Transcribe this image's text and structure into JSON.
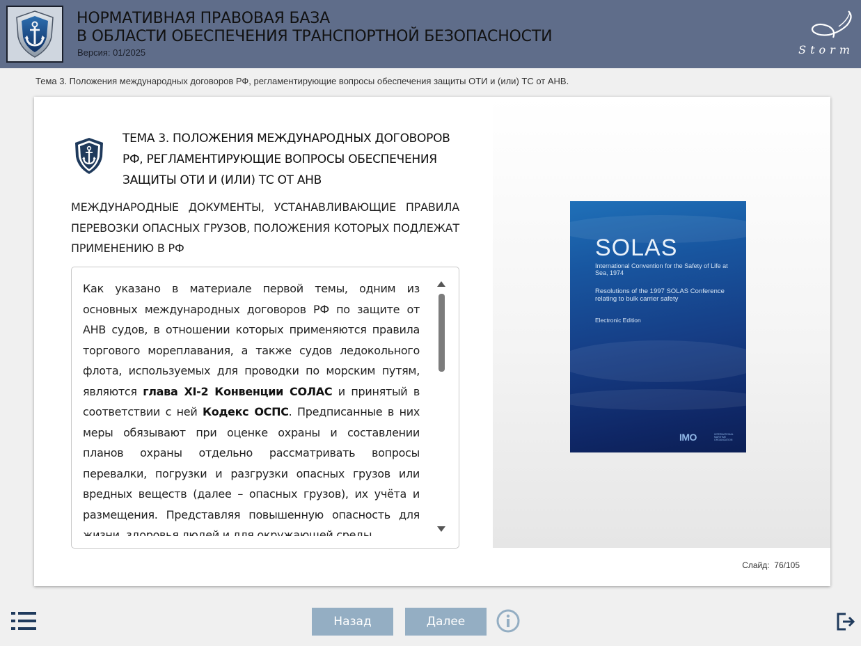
{
  "header": {
    "title_line1": "НОРМАТИВНАЯ ПРАВОВАЯ БАЗА",
    "title_line2": "В ОБЛАСТИ ОБЕСПЕЧЕНИЯ ТРАНСПОРТНОЙ БЕЗОПАСНОСТИ",
    "version": "Версия: 01/2025",
    "brand": "Storm",
    "logo_icon": "anchor-shield-icon"
  },
  "topic_line": "Тема 3. Положения международных договоров РФ, регламентирующие вопросы обеспечения защиты ОТИ и (или) ТС от АНВ.",
  "slide": {
    "heading": "ТЕМА 3. ПОЛОЖЕНИЯ МЕЖДУНАРОДНЫХ ДОГОВОРОВ РФ, РЕГЛАМЕНТИРУЮЩИЕ ВОПРОСЫ ОБЕСПЕЧЕНИЯ ЗАЩИТЫ ОТИ И (ИЛИ) ТС ОТ АНВ",
    "subheading": "МЕЖДУНАРОДНЫЕ ДОКУМЕНТЫ, УСТАНАВЛИВАЮЩИЕ ПРАВИЛА ПЕРЕВОЗКИ ОПАСНЫХ ГРУЗОВ, ПОЛОЖЕНИЯ КОТОРЫХ ПОДЛЕЖАТ ПРИМЕНЕНИЮ В РФ",
    "body_part1": "Как указано в материале первой темы, одним из основных международных договоров РФ по защите от АНВ судов, в отношении которых применяются правила торгового мореплавания, а также судов ледокольного флота, используемых для проводки по морским путям, являются ",
    "body_bold1": "глава XI-2 Конвенции СОЛАС",
    "body_part2": " и принятый в соответствии с ней ",
    "body_bold2": "Кодекс ОСПС",
    "body_part3": ". Предписанные в них меры обязывают при оценке охраны и составлении планов охраны отдельно рассматривать вопросы перевалки, погрузки и разгрузки опасных грузов или вредных веществ (далее – опасных грузов), их учёта и размещения. Представляя повышенную опасность для жизни, здоровья людей и для окружающей среды,",
    "book": {
      "title": "SOLAS",
      "subtitle": "International Convention for the Safety of Life at Sea, 1974",
      "resolutions": "Resolutions of the 1997 SOLAS Conference relating to bulk carrier safety",
      "edition": "Electronic Edition",
      "publisher": "IMO",
      "publisher_sub": "INTERNATIONAL MARITIME ORGANIZATION"
    },
    "counter_label": "Слайд:",
    "counter_current": "76",
    "counter_sep": "/",
    "counter_total": "105"
  },
  "footer": {
    "back_label": "Назад",
    "next_label": "Далее",
    "menu_icon": "list-icon",
    "info_icon": "info-icon",
    "exit_icon": "exit-icon"
  },
  "colors": {
    "header_bg": "#5f6d8a",
    "button_bg": "#94aec3",
    "accent_dark": "#1f3a5c"
  }
}
